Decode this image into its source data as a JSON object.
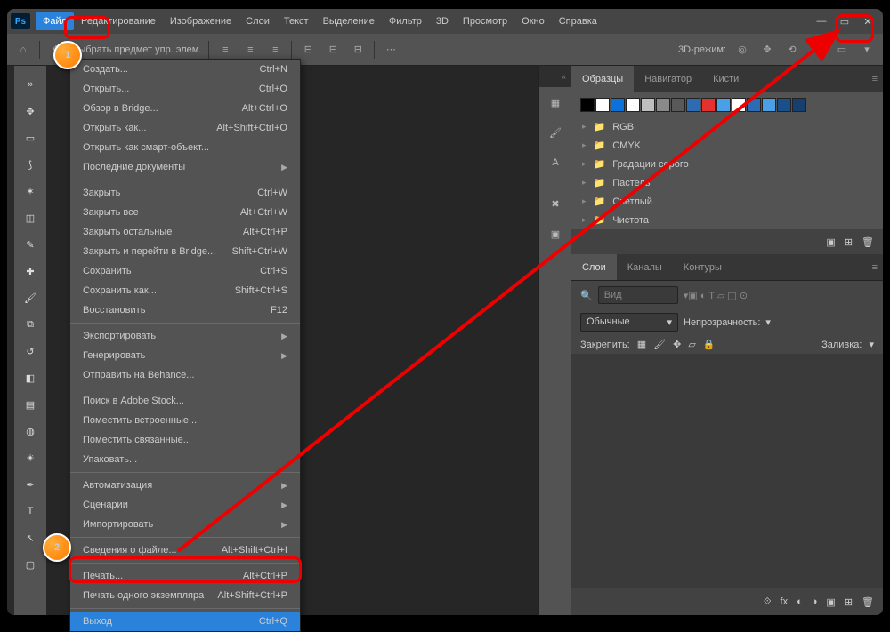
{
  "menubar": [
    "Файл",
    "Редактирование",
    "Изображение",
    "Слои",
    "Текст",
    "Выделение",
    "Фильтр",
    "3D",
    "Просмотр",
    "Окно",
    "Справка"
  ],
  "file_menu": [
    [
      {
        "l": "Создать...",
        "s": "Ctrl+N"
      },
      {
        "l": "Открыть...",
        "s": "Ctrl+O"
      },
      {
        "l": "Обзор в Bridge...",
        "s": "Alt+Ctrl+O"
      },
      {
        "l": "Открыть как...",
        "s": "Alt+Shift+Ctrl+O"
      },
      {
        "l": "Открыть как смарт-объект...",
        "s": ""
      },
      {
        "l": "Последние документы",
        "s": "",
        "sub": true
      }
    ],
    [
      {
        "l": "Закрыть",
        "s": "Ctrl+W"
      },
      {
        "l": "Закрыть все",
        "s": "Alt+Ctrl+W"
      },
      {
        "l": "Закрыть остальные",
        "s": "Alt+Ctrl+P"
      },
      {
        "l": "Закрыть и перейти в Bridge...",
        "s": "Shift+Ctrl+W"
      },
      {
        "l": "Сохранить",
        "s": "Ctrl+S"
      },
      {
        "l": "Сохранить как...",
        "s": "Shift+Ctrl+S"
      },
      {
        "l": "Восстановить",
        "s": "F12"
      }
    ],
    [
      {
        "l": "Экспортировать",
        "s": "",
        "sub": true
      },
      {
        "l": "Генерировать",
        "s": "",
        "sub": true
      },
      {
        "l": "Отправить на Behance...",
        "s": ""
      }
    ],
    [
      {
        "l": "Поиск в Adobe Stock...",
        "s": ""
      },
      {
        "l": "Поместить встроенные...",
        "s": ""
      },
      {
        "l": "Поместить связанные...",
        "s": ""
      },
      {
        "l": "Упаковать...",
        "s": ""
      }
    ],
    [
      {
        "l": "Автоматизация",
        "s": "",
        "sub": true
      },
      {
        "l": "Сценарии",
        "s": "",
        "sub": true
      },
      {
        "l": "Импортировать",
        "s": "",
        "sub": true
      }
    ],
    [
      {
        "l": "Сведения о файле...",
        "s": "Alt+Shift+Ctrl+I"
      }
    ],
    [
      {
        "l": "Печать...",
        "s": "Alt+Ctrl+P"
      },
      {
        "l": "Печать одного экземпляра",
        "s": "Alt+Shift+Ctrl+P"
      }
    ],
    [
      {
        "l": "Выход",
        "s": "Ctrl+Q",
        "hl": true
      }
    ]
  ],
  "optbar": {
    "label": "Выбрать предмет упр. элем.",
    "mode": "3D-режим:"
  },
  "swatches": {
    "tabs": [
      "Образцы",
      "Навигатор",
      "Кисти"
    ],
    "colors": [
      "#000",
      "#fff",
      "#0b72d9",
      "#fff",
      "#bfbfbf",
      "#8a8a8a",
      "#595959",
      "#2d6bb5",
      "#e53030",
      "#4aa0e6",
      "#fff",
      "#2d6bb5",
      "#4aa0e6",
      "#1a4f8a",
      "#163f6e"
    ],
    "groups": [
      "RGB",
      "CMYK",
      "Градации серого",
      "Пастель",
      "Светлый",
      "Чистота"
    ]
  },
  "layers": {
    "tabs": [
      "Слои",
      "Каналы",
      "Контуры"
    ],
    "filter": "Вид",
    "blend": "Обычные",
    "opacity": "Непрозрачность:",
    "lock": "Закрепить:",
    "fill": "Заливка:"
  },
  "badges": {
    "one": "1",
    "two": "2"
  }
}
